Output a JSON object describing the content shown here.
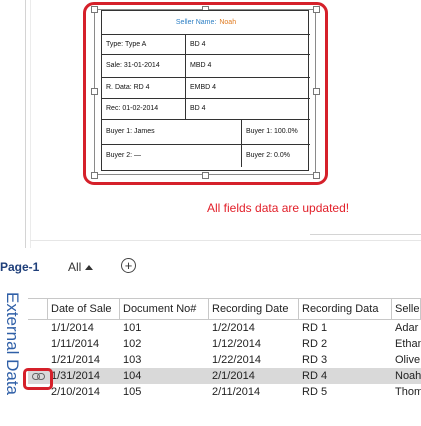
{
  "shape": {
    "seller_label": "Seller Name:",
    "seller_value": "Noah",
    "rows": [
      {
        "label": "Type: Type A",
        "value": "BD 4"
      },
      {
        "label": "Sale: 31-01-2014",
        "value": "MBD 4"
      },
      {
        "label": "R. Data: RD 4",
        "value": "EMBD 4"
      },
      {
        "label": "Rec: 01-02-2014",
        "value": "BD 4"
      }
    ],
    "buyer1_name": "Buyer 1: James",
    "buyer1_pct": "Buyer 1: 100.0%",
    "buyer2_name": "Buyer 2: —",
    "buyer2_pct": "Buyer 2: 0.0%"
  },
  "callout": "All fields data are updated!",
  "tabs": {
    "page": "Page-1",
    "all": "All",
    "add_icon": "plus-circle-icon"
  },
  "external_data": {
    "title": "External Data",
    "columns": [
      "Date of Sale",
      "Document No#",
      "Recording Date",
      "Recording Data",
      "Seller"
    ],
    "rows": [
      {
        "c1": "1/1/2014",
        "c2": "101",
        "c3": "1/2/2014",
        "c4": "RD 1",
        "c5": "Adar"
      },
      {
        "c1": "1/11/2014",
        "c2": "102",
        "c3": "1/12/2014",
        "c4": "RD 2",
        "c5": "Ethan"
      },
      {
        "c1": "1/21/2014",
        "c2": "103",
        "c3": "1/22/2014",
        "c4": "RD 3",
        "c5": "Olive"
      },
      {
        "c1": "1/31/2014",
        "c2": "104",
        "c3": "2/1/2014",
        "c4": "RD 4",
        "c5": "Noah"
      },
      {
        "c1": "2/10/2014",
        "c2": "105",
        "c3": "2/11/2014",
        "c4": "RD 5",
        "c5": "Thom"
      }
    ],
    "linked_row_index": 3,
    "link_icon": "chain-link-icon"
  },
  "colors": {
    "highlight": "#d5202a",
    "seller_label": "#2d7fc4",
    "seller_value": "#e07a1f",
    "pane_title": "#2f5fa7"
  }
}
